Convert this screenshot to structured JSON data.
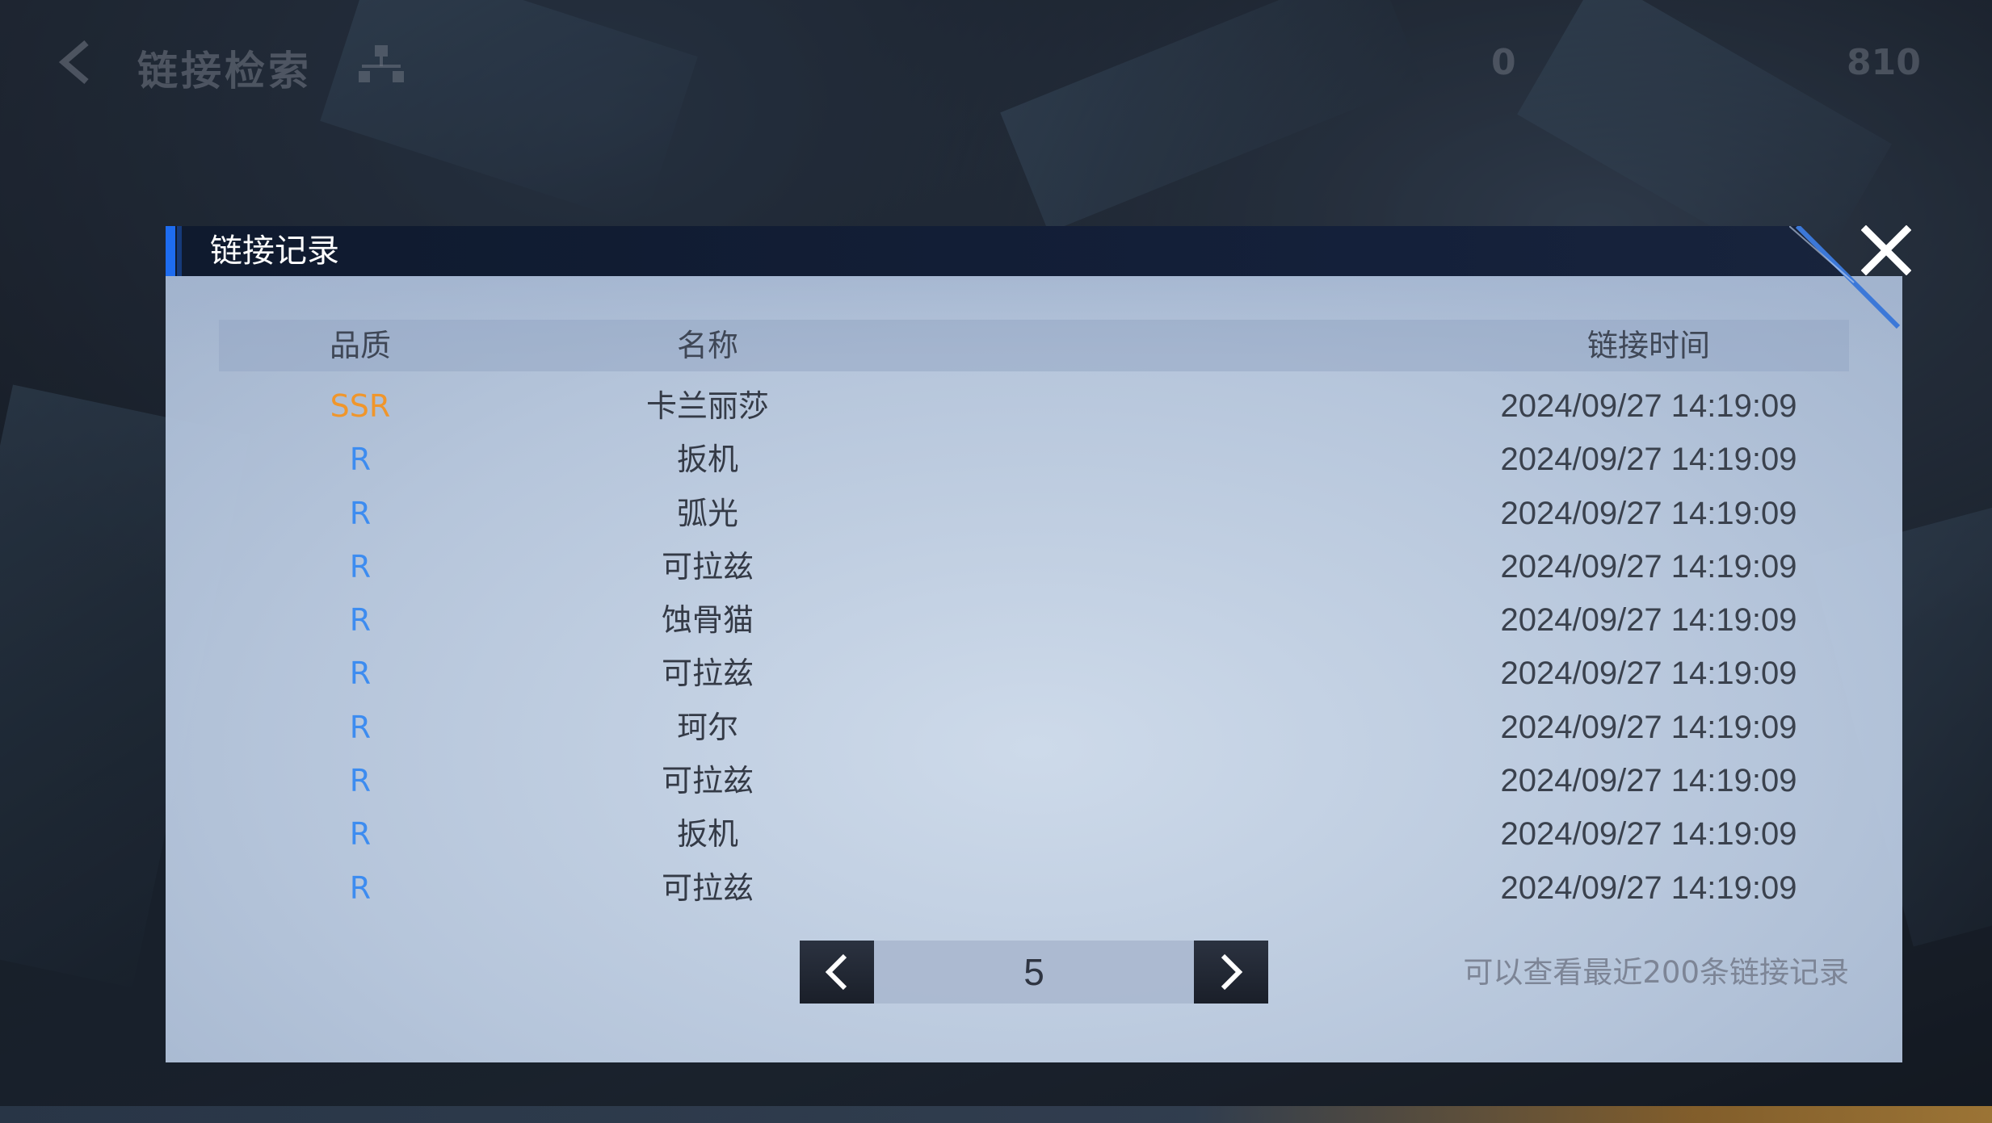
{
  "topbar": {
    "title": "链接检索",
    "resources": [
      "0",
      "810"
    ]
  },
  "modal": {
    "title": "链接记录",
    "columns": {
      "quality": "品质",
      "name": "名称",
      "time": "链接时间"
    },
    "rows": [
      {
        "quality": "SSR",
        "name": "卡兰丽莎",
        "time": "2024/09/27 14:19:09"
      },
      {
        "quality": "R",
        "name": "扳机",
        "time": "2024/09/27 14:19:09"
      },
      {
        "quality": "R",
        "name": "弧光",
        "time": "2024/09/27 14:19:09"
      },
      {
        "quality": "R",
        "name": "可拉兹",
        "time": "2024/09/27 14:19:09"
      },
      {
        "quality": "R",
        "name": "蚀骨猫",
        "time": "2024/09/27 14:19:09"
      },
      {
        "quality": "R",
        "name": "可拉兹",
        "time": "2024/09/27 14:19:09"
      },
      {
        "quality": "R",
        "name": "珂尔",
        "time": "2024/09/27 14:19:09"
      },
      {
        "quality": "R",
        "name": "可拉兹",
        "time": "2024/09/27 14:19:09"
      },
      {
        "quality": "R",
        "name": "扳机",
        "time": "2024/09/27 14:19:09"
      },
      {
        "quality": "R",
        "name": "可拉兹",
        "time": "2024/09/27 14:19:09"
      }
    ],
    "pager": {
      "current_page": "5"
    },
    "hint": "可以查看最近200条链接记录"
  },
  "colors": {
    "ssr": "#f0962b",
    "r": "#3d8cf0",
    "header_accent": "#1e6cf0"
  },
  "icons": {
    "back": "chevron-left-icon",
    "tree": "hierarchy-icon",
    "close": "close-icon",
    "prev": "chevron-left-icon",
    "next": "chevron-right-icon"
  }
}
